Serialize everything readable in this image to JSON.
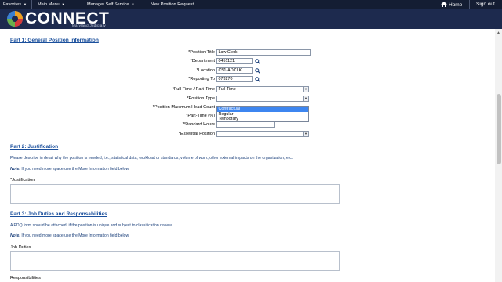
{
  "topnav": {
    "favorites": "Favorites",
    "main_menu": "Main Menu",
    "manager_self_service": "Manager Self Service",
    "breadcrumb_current": "New Position Request",
    "home": "Home",
    "sign_out": "Sign out"
  },
  "brand": {
    "name": "CONNECT",
    "sub": "Maryland Judiciary"
  },
  "part1": {
    "title": "Part 1: General Position Information",
    "fields": {
      "position_title": {
        "label": "*Position Title",
        "value": "Law Clerk"
      },
      "department": {
        "label": "*Department",
        "value": "0451121"
      },
      "location": {
        "label": "*Location",
        "value": "C51-ADCLK"
      },
      "reporting_to": {
        "label": "*Reporting To",
        "value": "073270"
      },
      "full_part_time": {
        "label": "*Full-Time / Part-Time",
        "value": "Full-Time"
      },
      "position_type": {
        "label": "*Position Type",
        "value": ""
      },
      "max_head_count": {
        "label": "*Position Maximum Head Count",
        "value": ""
      },
      "part_time_pct": {
        "label": "*Part-Time (%)",
        "value": ""
      },
      "standard_hours": {
        "label": "*Standard Hours",
        "value": ""
      },
      "essential_position": {
        "label": "*Essential Position",
        "value": ""
      }
    },
    "position_type_options": [
      "Contractual",
      "Regular",
      "Temporary"
    ]
  },
  "part2": {
    "title": "Part 2: Justification",
    "description": "Please describe in detail why the position is needed, i.e., statistical data, workload or standards, volume of work, other external impacts on the organization, etc.",
    "note_label": "Note:",
    "note_text": " If you need more space use the More Information field below.",
    "justification_label": "*Justification"
  },
  "part3": {
    "title": "Part 3: Job Duties and Responsabilities",
    "description": "A PDQ form should be attached, if the position is unique and subject to classification review.",
    "note_label": "Note:",
    "note_text": " If you need more space use the More Information field below.",
    "job_duties_label": "Job Duties",
    "responsibilities_label": "Responsibilities"
  },
  "colors": {
    "nav_bg": "#141d33",
    "brand_bg": "#1d2a4e",
    "section_blue": "#1a4f9c",
    "highlight": "#3d86f0"
  },
  "icons": {
    "home": "home-icon",
    "lookup": "magnifier-icon",
    "dropdown": "chevron-down-icon"
  }
}
